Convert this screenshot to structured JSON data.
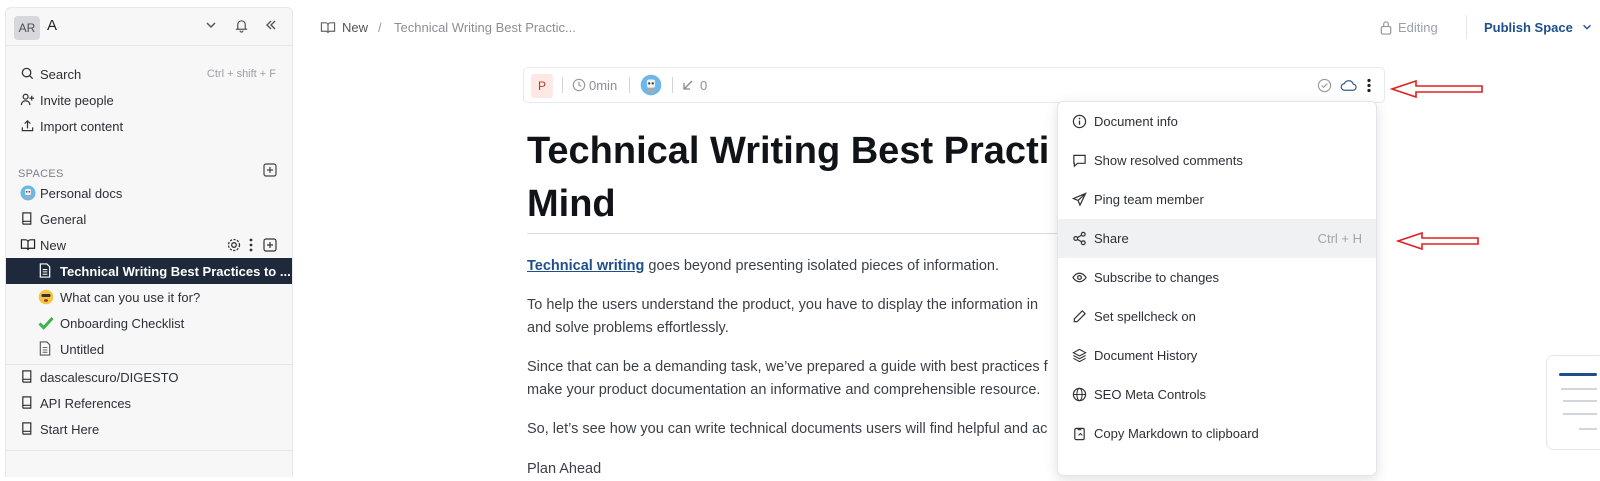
{
  "sidebar": {
    "avatar": "AR",
    "workspace": "A",
    "search": {
      "label": "Search",
      "shortcut": "Ctrl + shift + F"
    },
    "invite": "Invite people",
    "import": "Import content",
    "spaces_label": "SPACES",
    "spaces": [
      {
        "label": "Personal docs"
      },
      {
        "label": "General"
      },
      {
        "label": "New"
      }
    ],
    "pages": [
      {
        "label": "Technical Writing Best Practices to ..."
      },
      {
        "label": "What can you use it for?"
      },
      {
        "label": "Onboarding Checklist"
      },
      {
        "label": "Untitled"
      }
    ],
    "more_spaces": [
      {
        "label": "dascalescuro/DIGESTO"
      },
      {
        "label": "API References"
      },
      {
        "label": "Start Here"
      }
    ]
  },
  "breadcrumb": {
    "space": "New",
    "separator": "/",
    "page": "Technical Writing Best Practic..."
  },
  "topbar": {
    "editing": "Editing",
    "publish": "Publish Space"
  },
  "doc_toolbar": {
    "badge": "P",
    "read_time": "0min",
    "count": "0"
  },
  "document": {
    "title": "Technical Writing Best Practices to Keep in Mind",
    "title_line1": "Technical Writing Best Practi",
    "title_line2": "Mind",
    "p1_link": "Technical writing",
    "p1_rest": " goes beyond presenting isolated pieces of information.",
    "p2_line1": "To help the users understand the product, you have to display the information in",
    "p2_line2": "and solve problems effortlessly.",
    "p3_line1": "Since that can be a demanding task, we’ve prepared a guide with best practices f",
    "p3_line2": "make your product documentation an informative and comprehensible resource.",
    "p4": "So, let’s see how you can write technical documents users will find helpful and ac",
    "p5": "Plan Ahead"
  },
  "menu": {
    "items": [
      {
        "label": "Document info",
        "icon": "info-icon"
      },
      {
        "label": "Show resolved comments",
        "icon": "comment-icon"
      },
      {
        "label": "Ping team member",
        "icon": "send-icon"
      },
      {
        "label": "Share",
        "icon": "share-icon",
        "shortcut": "Ctrl + H"
      },
      {
        "label": "Subscribe to changes",
        "icon": "eye-icon"
      },
      {
        "label": "Set spellcheck on",
        "icon": "pencil-icon"
      },
      {
        "label": "Document History",
        "icon": "layers-icon"
      },
      {
        "label": "SEO Meta Controls",
        "icon": "globe-icon"
      },
      {
        "label": "Copy Markdown to clipboard",
        "icon": "clipboard-icon"
      }
    ]
  },
  "colors": {
    "accent": "#1e4f8a",
    "active_bg": "#1e2a3b",
    "annotation": "#e02020"
  }
}
